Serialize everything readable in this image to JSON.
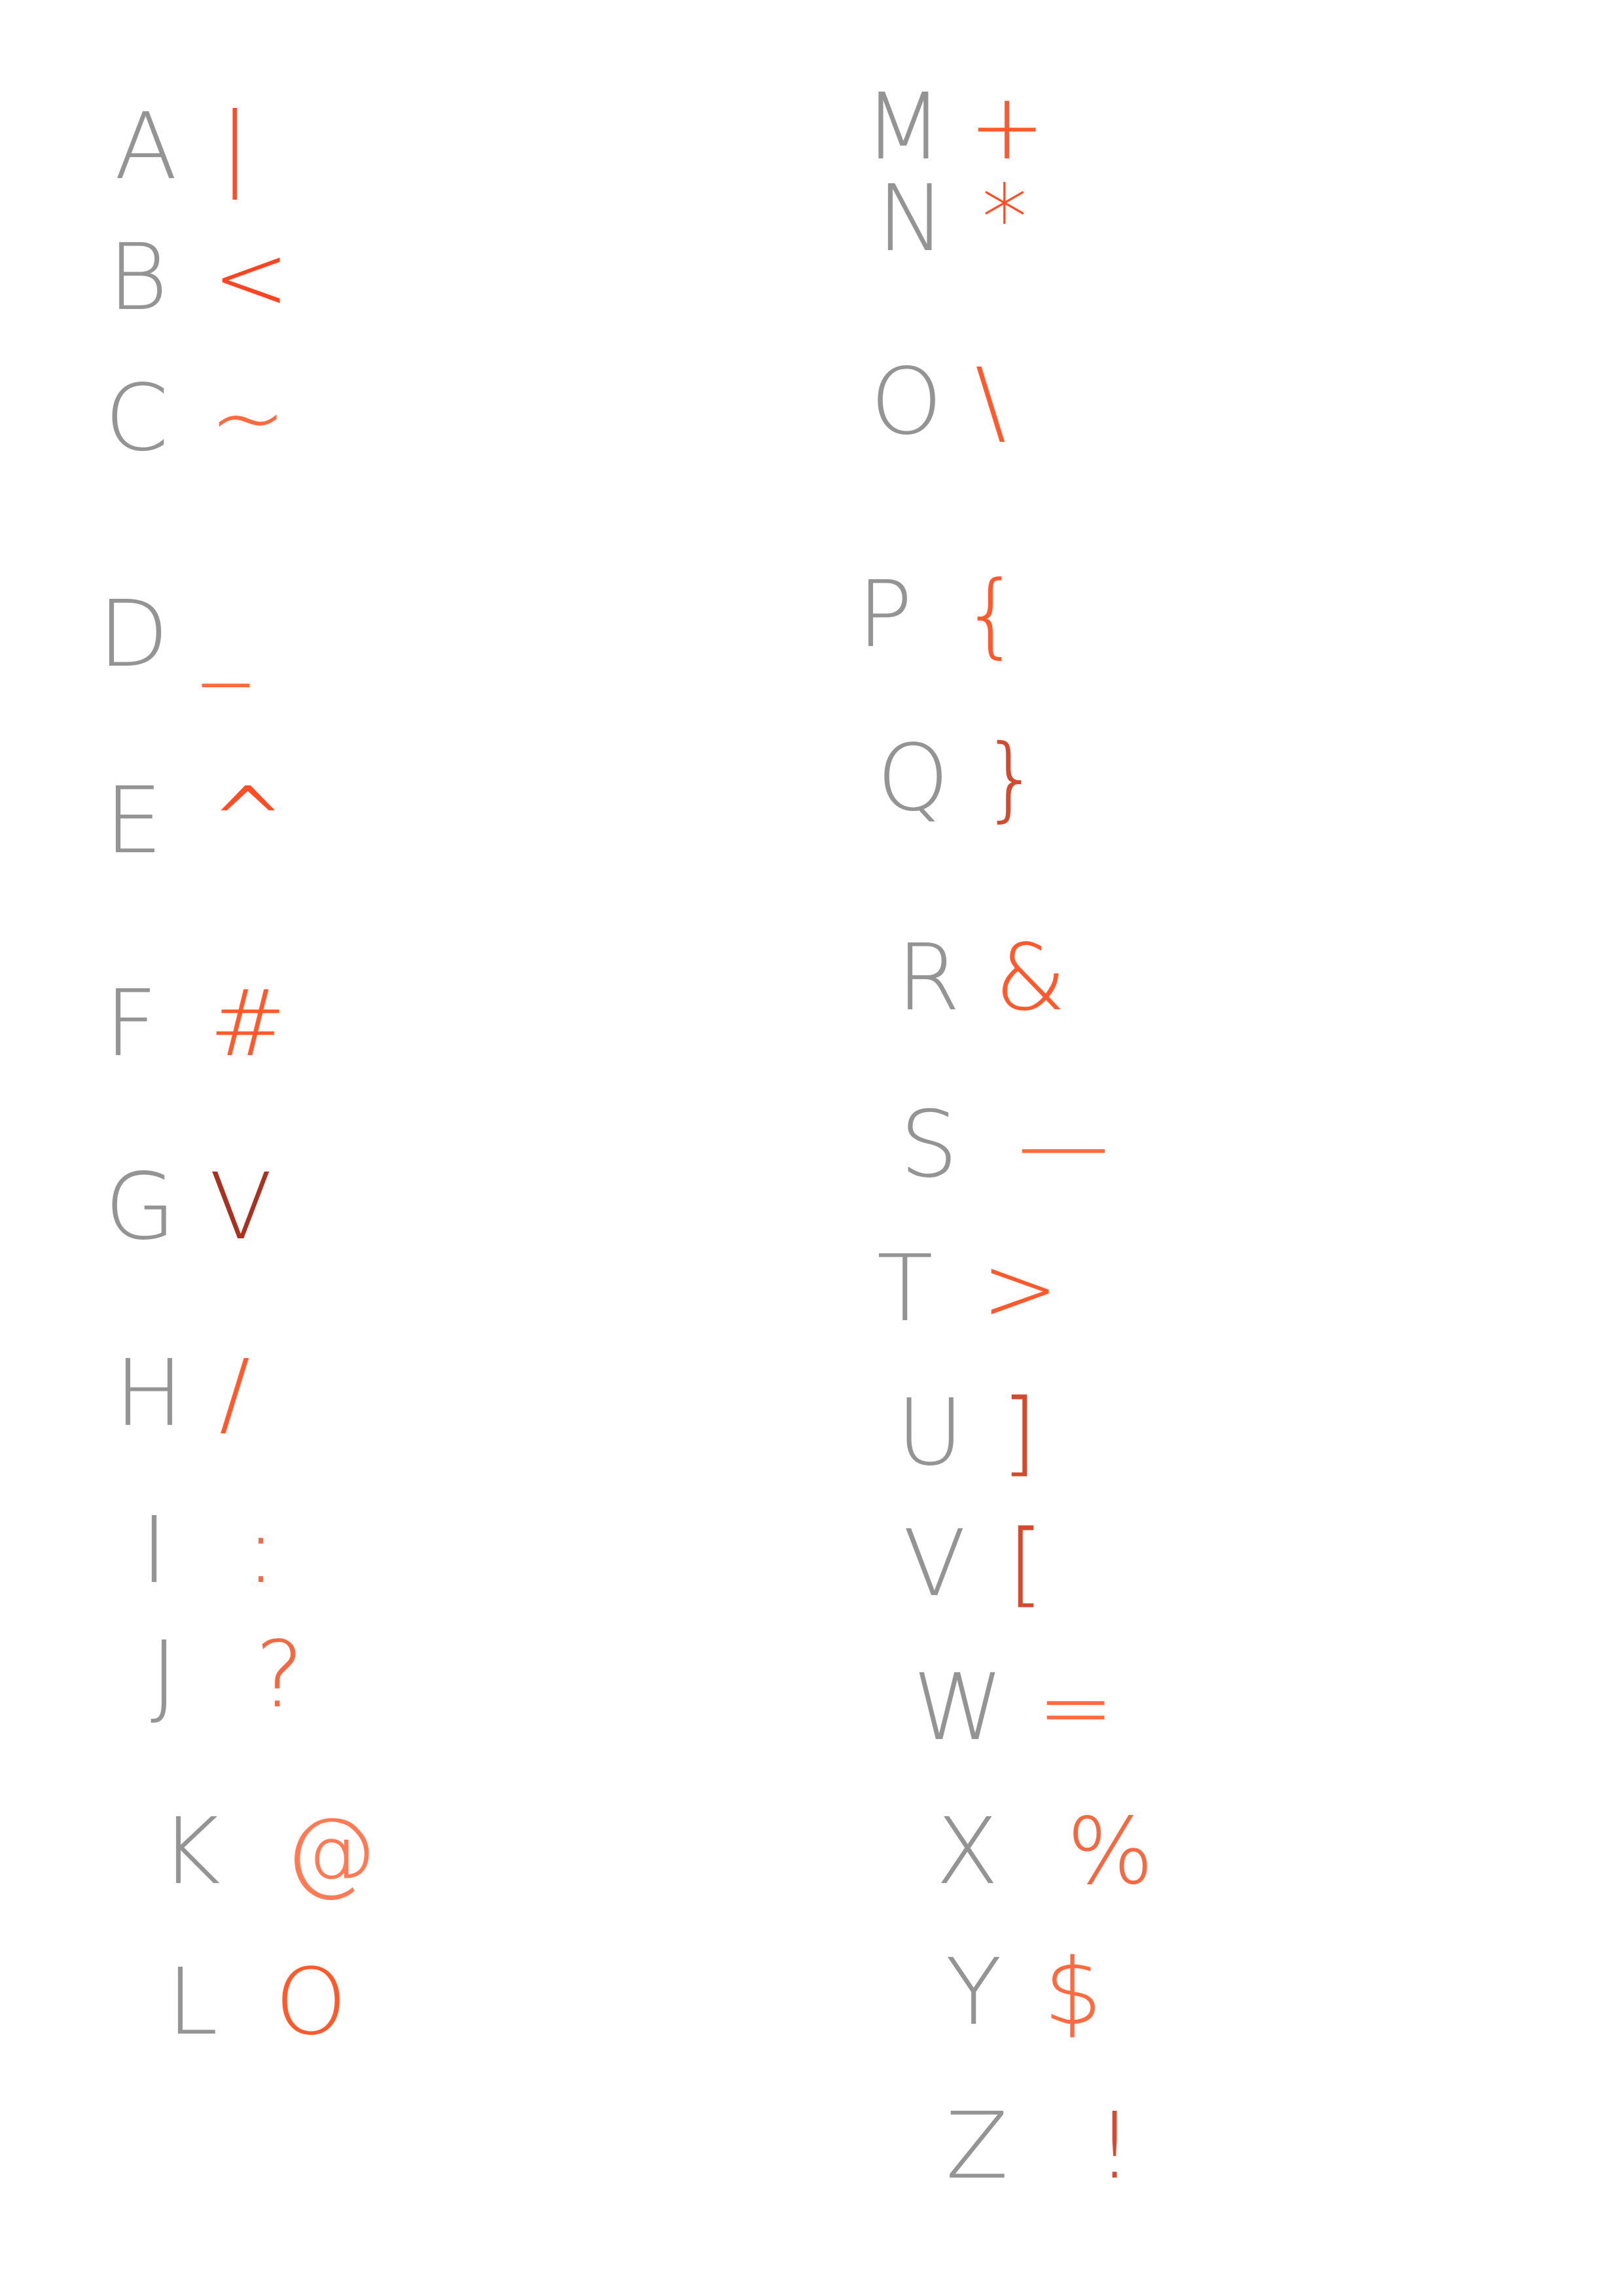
{
  "colors": {
    "letter": "#8f8f8f",
    "symbol_bright": "#ff5a2e",
    "symbol_mid": "#f26a44",
    "symbol_dark": "#c0392b",
    "symbol_deep": "#a52a1a"
  },
  "left_column": [
    {
      "letter": "A",
      "symbol": "|",
      "color": "#ff4d26"
    },
    {
      "letter": "B",
      "symbol": "<",
      "color": "#ff4422"
    },
    {
      "letter": "C",
      "symbol": "~",
      "color": "#ff6a40"
    },
    {
      "letter": "D",
      "symbol": "_",
      "color": "#ff6a40"
    },
    {
      "letter": "E",
      "symbol": "^",
      "color": "#ff4d26"
    },
    {
      "letter": "F",
      "symbol": "#",
      "color": "#ff5a2e"
    },
    {
      "letter": "G",
      "symbol": "V",
      "color": "#a83222"
    },
    {
      "letter": "H",
      "symbol": "/",
      "color": "#ff5a2e"
    },
    {
      "letter": "I",
      "symbol": ":",
      "color": "#f26a44"
    },
    {
      "letter": "J",
      "symbol": "?",
      "color": "#f26a44"
    },
    {
      "letter": "K",
      "symbol": "@",
      "color": "#ff7a55"
    },
    {
      "letter": "L",
      "symbol": "O",
      "color": "#ff5a2e"
    }
  ],
  "right_column": [
    {
      "letter": "M",
      "symbol": "+",
      "color": "#ff5a2e"
    },
    {
      "letter": "N",
      "symbol": "*",
      "color": "#ff4d26"
    },
    {
      "letter": "O",
      "symbol": "\\",
      "color": "#ff5a2e"
    },
    {
      "letter": "P",
      "symbol": "{",
      "color": "#ff5a2e"
    },
    {
      "letter": "Q",
      "symbol": "}",
      "color": "#d24a30"
    },
    {
      "letter": "R",
      "symbol": "&",
      "color": "#ff5a2e"
    },
    {
      "letter": "S",
      "symbol": "—",
      "color": "#ff6a40"
    },
    {
      "letter": "T",
      "symbol": ">",
      "color": "#ff5a2e"
    },
    {
      "letter": "U",
      "symbol": "]",
      "color": "#d24a30"
    },
    {
      "letter": "V",
      "symbol": "[",
      "color": "#d24a30"
    },
    {
      "letter": "W",
      "symbol": "=",
      "color": "#ff6a40"
    },
    {
      "letter": "X",
      "symbol": "%",
      "color": "#f26a44"
    },
    {
      "letter": "Y",
      "symbol": "$",
      "color": "#ff6a40"
    },
    {
      "letter": "Z",
      "symbol": "!",
      "color": "#d24a30"
    }
  ]
}
